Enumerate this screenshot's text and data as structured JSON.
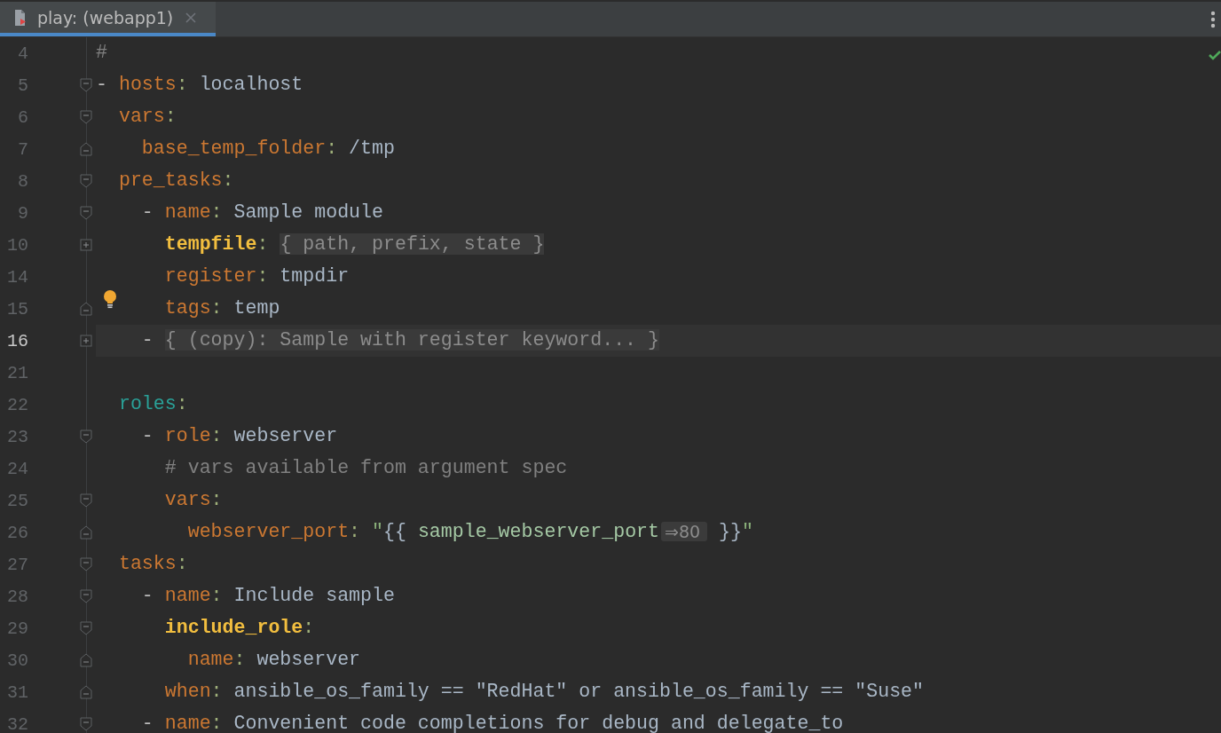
{
  "tab": {
    "title": "play: (webapp1)",
    "selected": true
  },
  "lines": [
    {
      "number": "4",
      "kind": "plain",
      "current": false,
      "bulb": false,
      "tokens": [
        {
          "kind": "comment",
          "text": "#"
        }
      ]
    },
    {
      "number": "5",
      "kind": "block-start",
      "expanded": true,
      "current": false,
      "bulb": false,
      "tokens": [
        {
          "kind": "dash",
          "text": "- "
        },
        {
          "kind": "key",
          "text": "hosts"
        },
        {
          "kind": "colon",
          "text": ": "
        },
        {
          "kind": "value",
          "text": "localhost"
        }
      ]
    },
    {
      "number": "6",
      "kind": "block-start",
      "expanded": true,
      "current": false,
      "bulb": false,
      "tokens": [
        {
          "kind": "key",
          "text": "  vars"
        },
        {
          "kind": "colon",
          "text": ":"
        }
      ]
    },
    {
      "number": "7",
      "kind": "block-end",
      "current": false,
      "bulb": false,
      "tokens": [
        {
          "kind": "key",
          "text": "    base_temp_folder"
        },
        {
          "kind": "colon",
          "text": ": "
        },
        {
          "kind": "value",
          "text": "/tmp"
        }
      ]
    },
    {
      "number": "8",
      "kind": "block-start",
      "expanded": true,
      "current": false,
      "bulb": false,
      "tokens": [
        {
          "kind": "key",
          "text": "  pre_tasks"
        },
        {
          "kind": "colon",
          "text": ":"
        }
      ]
    },
    {
      "number": "9",
      "kind": "block-start",
      "expanded": true,
      "current": false,
      "bulb": false,
      "tokens": [
        {
          "kind": "dash",
          "text": "    - "
        },
        {
          "kind": "key",
          "text": "name"
        },
        {
          "kind": "colon",
          "text": ": "
        },
        {
          "kind": "value",
          "text": "Sample module"
        }
      ]
    },
    {
      "number": "10",
      "kind": "block-start",
      "expanded": false,
      "current": false,
      "bulb": false,
      "tokens": [
        {
          "kind": "keybold",
          "text": "      tempfile"
        },
        {
          "kind": "colon",
          "text": ":"
        },
        {
          "kind": "folded",
          "text": " { path, prefix, state }"
        }
      ]
    },
    {
      "number": "14",
      "kind": "plain",
      "current": false,
      "bulb": false,
      "tokens": [
        {
          "kind": "key",
          "text": "      register"
        },
        {
          "kind": "colon",
          "text": ": "
        },
        {
          "kind": "value",
          "text": "tmpdir"
        }
      ]
    },
    {
      "number": "15",
      "kind": "block-end",
      "current": false,
      "bulb": true,
      "tokens": [
        {
          "kind": "key",
          "text": "      tags"
        },
        {
          "kind": "colon",
          "text": ": "
        },
        {
          "kind": "value",
          "text": "temp"
        }
      ]
    },
    {
      "number": "16",
      "kind": "block-start",
      "expanded": false,
      "current": true,
      "bulb": false,
      "tokens": [
        {
          "kind": "dash",
          "text": "    - "
        },
        {
          "kind": "folded",
          "text": "{ (copy): Sample with register keyword... }"
        }
      ]
    },
    {
      "number": "21",
      "kind": "plain",
      "current": false,
      "bulb": false
    },
    {
      "number": "22",
      "kind": "plain",
      "current": false,
      "bulb": false,
      "tokens": [
        {
          "kind": "section",
          "text": "  roles"
        },
        {
          "kind": "colon",
          "text": ":"
        }
      ]
    },
    {
      "number": "23",
      "kind": "block-start",
      "expanded": true,
      "current": false,
      "bulb": false,
      "tokens": [
        {
          "kind": "dash",
          "text": "    - "
        },
        {
          "kind": "key",
          "text": "role"
        },
        {
          "kind": "colon",
          "text": ": "
        },
        {
          "kind": "value",
          "text": "webserver"
        }
      ]
    },
    {
      "number": "24",
      "kind": "plain",
      "current": false,
      "bulb": false,
      "tokens": [
        {
          "kind": "comment",
          "text": "      # vars available from argument spec"
        }
      ]
    },
    {
      "number": "25",
      "kind": "block-start",
      "expanded": true,
      "current": false,
      "bulb": false,
      "tokens": [
        {
          "kind": "key",
          "text": "      vars"
        },
        {
          "kind": "colon",
          "text": ":"
        }
      ]
    },
    {
      "number": "26",
      "kind": "block-end",
      "current": false,
      "bulb": false,
      "tokens": [
        {
          "kind": "key",
          "text": "        webserver_port"
        },
        {
          "kind": "colon",
          "text": ": "
        },
        {
          "kind": "string",
          "text": "\""
        },
        {
          "kind": "brace",
          "text": "{{"
        },
        {
          "kind": "var",
          "text": " sample_webserver_port"
        },
        {
          "kind": "hint",
          "text": "⇒80"
        },
        {
          "kind": "brace",
          "text": " }}"
        },
        {
          "kind": "string",
          "text": "\""
        }
      ]
    },
    {
      "number": "27",
      "kind": "block-start",
      "expanded": true,
      "current": false,
      "bulb": false,
      "tokens": [
        {
          "kind": "key",
          "text": "  tasks"
        },
        {
          "kind": "colon",
          "text": ":"
        }
      ]
    },
    {
      "number": "28",
      "kind": "block-start",
      "expanded": true,
      "current": false,
      "bulb": false,
      "tokens": [
        {
          "kind": "dash",
          "text": "    - "
        },
        {
          "kind": "key",
          "text": "name"
        },
        {
          "kind": "colon",
          "text": ": "
        },
        {
          "kind": "value",
          "text": "Include sample"
        }
      ]
    },
    {
      "number": "29",
      "kind": "block-start",
      "expanded": true,
      "current": false,
      "bulb": false,
      "tokens": [
        {
          "kind": "keybold",
          "text": "      include_role"
        },
        {
          "kind": "colon",
          "text": ":"
        }
      ]
    },
    {
      "number": "30",
      "kind": "block-end",
      "current": false,
      "bulb": false,
      "tokens": [
        {
          "kind": "key",
          "text": "        name"
        },
        {
          "kind": "colon",
          "text": ": "
        },
        {
          "kind": "value",
          "text": "webserver"
        }
      ]
    },
    {
      "number": "31",
      "kind": "block-end",
      "current": false,
      "bulb": false,
      "tokens": [
        {
          "kind": "key",
          "text": "      when"
        },
        {
          "kind": "colon",
          "text": ": "
        },
        {
          "kind": "value",
          "text": "ansible_os_family == \"RedHat\" or ansible_os_family == \"Suse\""
        }
      ]
    },
    {
      "number": "32",
      "kind": "block-start",
      "expanded": true,
      "current": false,
      "bulb": false,
      "tokens": [
        {
          "kind": "dash",
          "text": "    - "
        },
        {
          "kind": "key",
          "text": "name"
        },
        {
          "kind": "colon",
          "text": ": "
        },
        {
          "kind": "value",
          "text": "Convenient code completions for debug and delegate_to"
        }
      ]
    }
  ]
}
